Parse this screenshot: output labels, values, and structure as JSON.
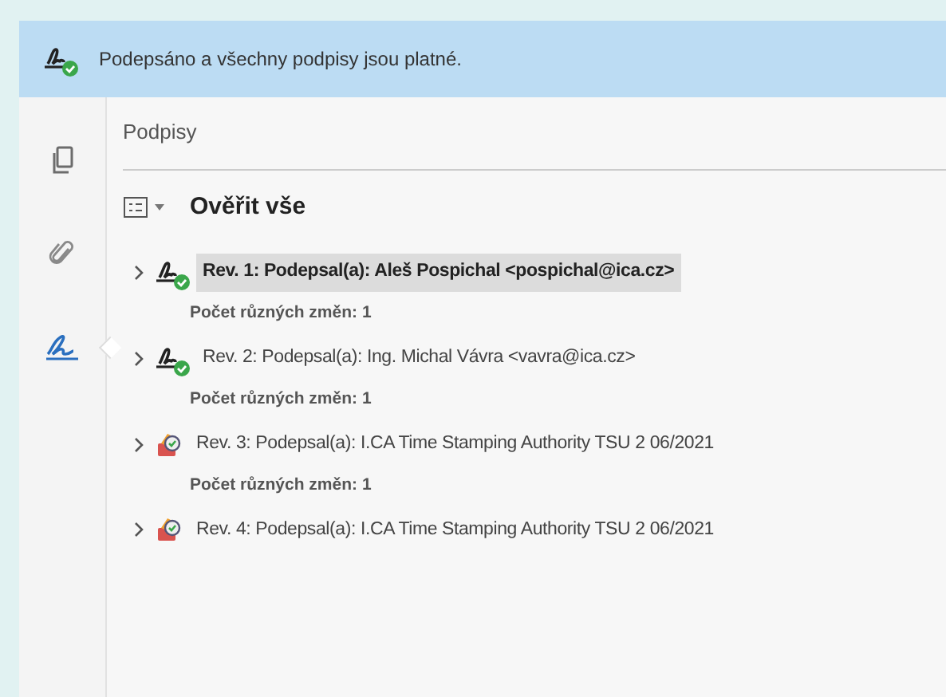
{
  "banner": {
    "text": "Podepsáno a všechny podpisy jsou platné."
  },
  "sidebar": {
    "items": [
      {
        "kind": "pages",
        "selected": false
      },
      {
        "kind": "attachments",
        "selected": false
      },
      {
        "kind": "signatures",
        "selected": true
      }
    ]
  },
  "panel": {
    "title": "Podpisy",
    "toolbar": {
      "action": "Ověřit vše"
    },
    "revisions": [
      {
        "kind": "signature",
        "label": "Rev. 1: Podepsal(a): Aleš Pospichal <pospichal@ica.cz>",
        "selected": true,
        "expanded": false,
        "detail": "Počet různých změn: 1"
      },
      {
        "kind": "signature",
        "label": "Rev. 2: Podepsal(a): Ing. Michal Vávra <vavra@ica.cz>",
        "selected": false,
        "expanded": false,
        "detail": "Počet různých změn: 1"
      },
      {
        "kind": "timestamp",
        "label": "Rev. 3: Podepsal(a): I.CA Time Stamping Authority TSU 2 06/2021",
        "selected": false,
        "expanded": false,
        "detail": "Počet různých změn: 1"
      },
      {
        "kind": "timestamp",
        "label": "Rev. 4: Podepsal(a): I.CA Time Stamping Authority TSU 2 06/2021",
        "selected": false,
        "expanded": false
      }
    ]
  }
}
